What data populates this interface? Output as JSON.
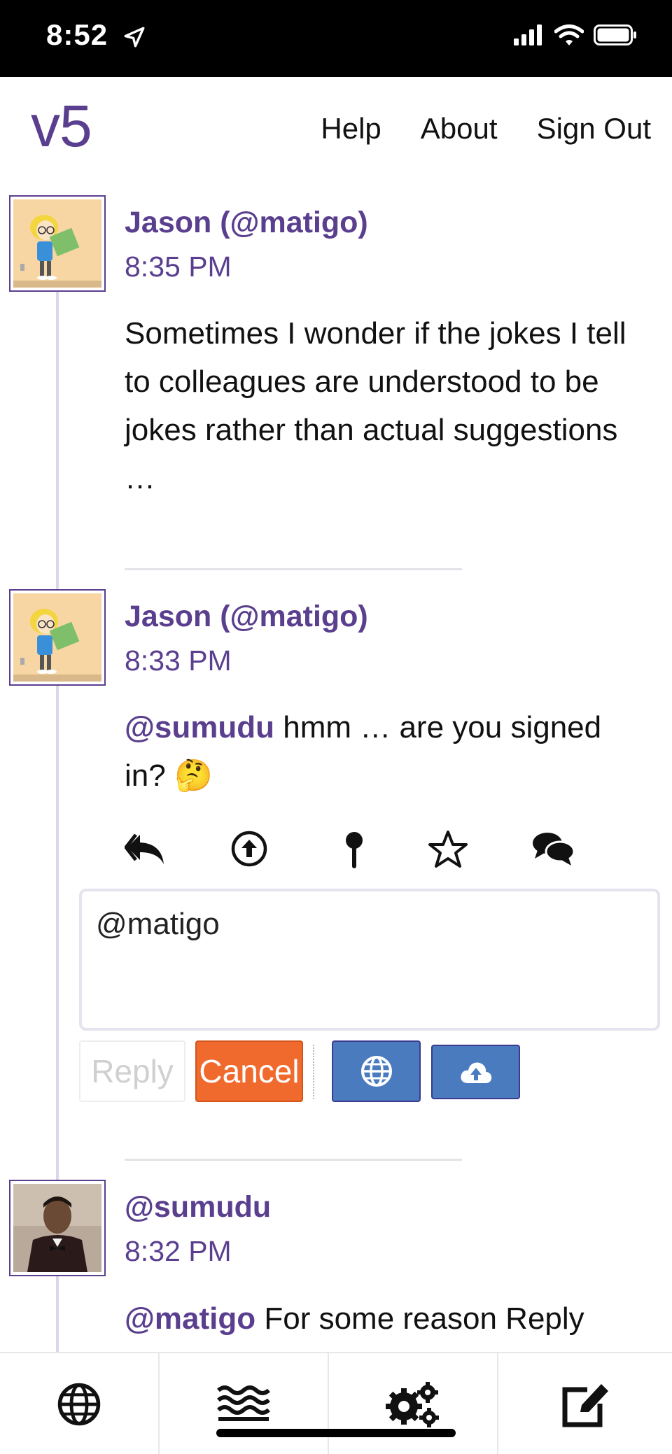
{
  "status_bar": {
    "time": "8:52",
    "icons": [
      "location-arrow-icon",
      "signal-icon",
      "wifi-icon",
      "battery-icon"
    ]
  },
  "header": {
    "logo": "v5",
    "nav": [
      {
        "label": "Help"
      },
      {
        "label": "About"
      },
      {
        "label": "Sign Out"
      }
    ]
  },
  "posts": [
    {
      "author": "Jason (@matigo)",
      "time": "8:35 PM",
      "body": "Sometimes I wonder if the jokes I tell to colleagues are understood to be jokes rather than actual suggestions …"
    },
    {
      "author": "Jason (@matigo)",
      "time": "8:33 PM",
      "mention": "@sumudu",
      "body": " hmm … are you signed in? 🤔"
    },
    {
      "author": "@sumudu",
      "time": "8:32 PM",
      "mention": "@matigo",
      "body": " For some reason Reply"
    }
  ],
  "post_actions": [
    "reply-all-icon",
    "boost-icon",
    "pin-icon",
    "star-icon",
    "thread-icon"
  ],
  "reply_form": {
    "text": "@matigo",
    "reply_label": "Reply",
    "cancel_label": "Cancel"
  },
  "tab_bar": [
    "globe-icon",
    "timeline-icon",
    "settings-icon",
    "compose-icon"
  ],
  "colors": {
    "accent": "#5b3f8f",
    "cancel": "#f06a2e",
    "action_button": "#4a7bbf"
  }
}
